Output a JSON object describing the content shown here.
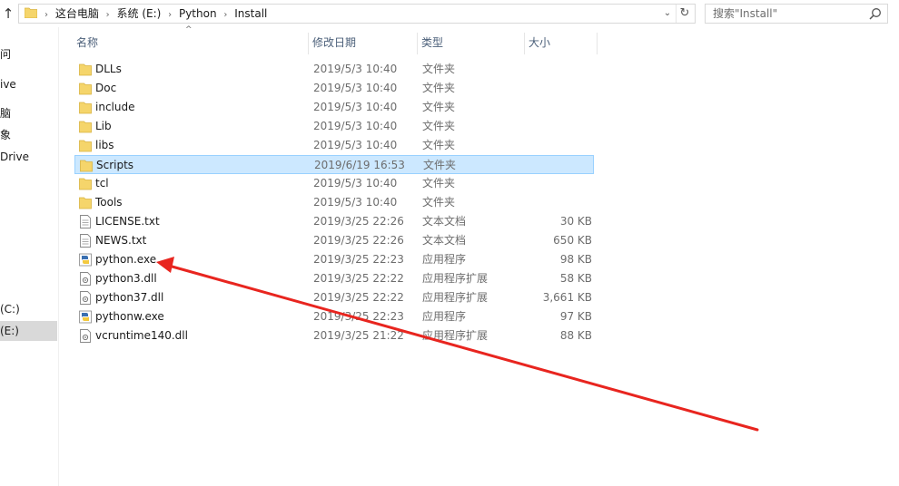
{
  "address": {
    "crumbs": [
      "这台电脑",
      "系统 (E:)",
      "Python",
      "Install"
    ]
  },
  "search": {
    "placeholder": "搜索\"Install\""
  },
  "nav": {
    "items": [
      {
        "label": "问",
        "selected": false
      },
      {
        "label": "ive",
        "selected": false
      },
      {
        "label": "脑",
        "selected": false
      },
      {
        "label": "象",
        "selected": false
      },
      {
        "label": "Drive",
        "selected": false
      },
      {
        "label": "(C:)",
        "selected": false
      },
      {
        "label": "(E:)",
        "selected": true
      }
    ]
  },
  "columns": {
    "name": "名称",
    "date": "修改日期",
    "type": "类型",
    "size": "大小"
  },
  "files": [
    {
      "name": "DLLs",
      "date": "2019/5/3 10:40",
      "type": "文件夹",
      "size": "",
      "icon": "folder-icon",
      "selected": false
    },
    {
      "name": "Doc",
      "date": "2019/5/3 10:40",
      "type": "文件夹",
      "size": "",
      "icon": "folder-icon",
      "selected": false
    },
    {
      "name": "include",
      "date": "2019/5/3 10:40",
      "type": "文件夹",
      "size": "",
      "icon": "folder-icon",
      "selected": false
    },
    {
      "name": "Lib",
      "date": "2019/5/3 10:40",
      "type": "文件夹",
      "size": "",
      "icon": "folder-icon",
      "selected": false
    },
    {
      "name": "libs",
      "date": "2019/5/3 10:40",
      "type": "文件夹",
      "size": "",
      "icon": "folder-icon",
      "selected": false
    },
    {
      "name": "Scripts",
      "date": "2019/6/19 16:53",
      "type": "文件夹",
      "size": "",
      "icon": "folder-icon",
      "selected": true
    },
    {
      "name": "tcl",
      "date": "2019/5/3 10:40",
      "type": "文件夹",
      "size": "",
      "icon": "folder-icon",
      "selected": false
    },
    {
      "name": "Tools",
      "date": "2019/5/3 10:40",
      "type": "文件夹",
      "size": "",
      "icon": "folder-icon",
      "selected": false
    },
    {
      "name": "LICENSE.txt",
      "date": "2019/3/25 22:26",
      "type": "文本文档",
      "size": "30 KB",
      "icon": "text-file-icon",
      "selected": false
    },
    {
      "name": "NEWS.txt",
      "date": "2019/3/25 22:26",
      "type": "文本文档",
      "size": "650 KB",
      "icon": "text-file-icon",
      "selected": false
    },
    {
      "name": "python.exe",
      "date": "2019/3/25 22:23",
      "type": "应用程序",
      "size": "98 KB",
      "icon": "python-exe-icon",
      "selected": false
    },
    {
      "name": "python3.dll",
      "date": "2019/3/25 22:22",
      "type": "应用程序扩展",
      "size": "58 KB",
      "icon": "dll-file-icon",
      "selected": false
    },
    {
      "name": "python37.dll",
      "date": "2019/3/25 22:22",
      "type": "应用程序扩展",
      "size": "3,661 KB",
      "icon": "dll-file-icon",
      "selected": false
    },
    {
      "name": "pythonw.exe",
      "date": "2019/3/25 22:23",
      "type": "应用程序",
      "size": "97 KB",
      "icon": "python-exe-icon",
      "selected": false
    },
    {
      "name": "vcruntime140.dll",
      "date": "2019/3/25 21:22",
      "type": "应用程序扩展",
      "size": "88 KB",
      "icon": "dll-file-icon",
      "selected": false
    }
  ],
  "colors": {
    "selection_bg": "#cce8ff",
    "selection_border": "#99d1ff",
    "folder": "#f5d56b",
    "annotation_arrow": "#e8251f"
  }
}
